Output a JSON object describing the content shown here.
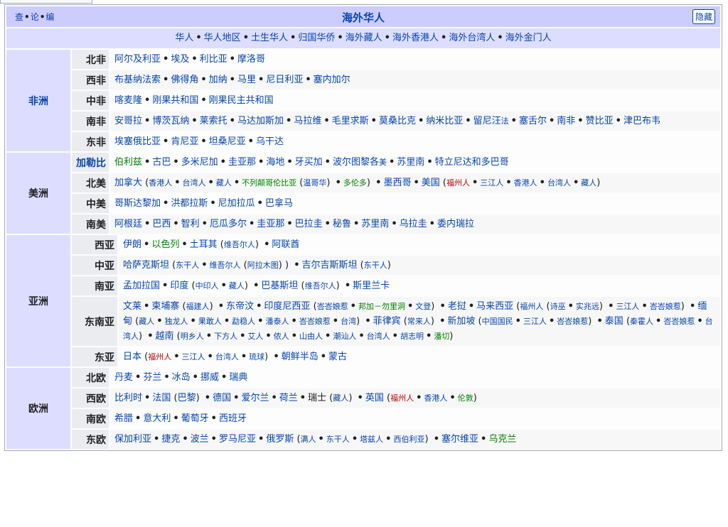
{
  "vte": [
    {
      "label": "查",
      "href_kind": "view"
    },
    {
      "label": "论",
      "href_kind": "talk"
    },
    {
      "label": "编",
      "href_kind": "edit"
    }
  ],
  "title": "海外华人",
  "hide_label": "隐藏",
  "subheader": [
    "华人",
    "华人地区",
    "土生华人",
    "归国华侨",
    "海外藏人",
    "海外香港人",
    "海外台湾人",
    "海外金门人"
  ],
  "colors": {
    "title_bg": "#ccccff",
    "group_bg": "#ddddff",
    "row_label_bg": "#eaecf0",
    "link": "#0645ad",
    "link_green": "#008000",
    "link_red": "#ba0000"
  },
  "groups": [
    {
      "name": "非洲",
      "link": true,
      "rows": [
        {
          "label": "北非",
          "text": "[阿尔及利亚] • [埃及] • [利比亚] • [摩洛哥]"
        },
        {
          "label": "西非",
          "text": "[布基纳法索] • [佛得角] • [加纳] • [马里] • [尼日利亚] • [塞内加尔]"
        },
        {
          "label": "中非",
          "text": "[喀麦隆] • [刚果共和国] • [刚果民主共和国]"
        },
        {
          "label": "南非",
          "text": "[安哥拉] • [博茨瓦纳] • [莱索托] • [马达加斯加] • [马拉维] • [毛里求斯] • [莫桑比克] • [纳米比亚] • [留尼汪] {[法]} • [塞舌尔] • [南非] • [赞比亚] • [津巴布韦]"
        },
        {
          "label": "东非",
          "text": "[埃塞俄比亚] • [肯尼亚] • [坦桑尼亚] • [乌干达]"
        }
      ]
    },
    {
      "name": "美洲",
      "link": false,
      "rows": [
        {
          "label": "加勒比",
          "label_link": true,
          "text": "(伯利兹) • [古巴] • [多米尼加] • [圭亚那] • [海地] • [牙买加] • [波尔图黎各] {[美]} • [苏里南] • [特立尼达和多巴哥]"
        },
        {
          "label": "北美",
          "text": "[加拿大] { ( [香港人] • [台湾人] • [藏人] • (不列颠哥伦比亚) ( [温哥华] ) • (多伦多) ) } • [墨西哥] • [美国] { ( <福州人> • [三江人] • [香港人] • [台湾人] • [藏人] ) }"
        },
        {
          "label": "中美",
          "text": "[哥斯达黎加] • [洪都拉斯] • [尼加拉瓜] • [巴拿马]"
        },
        {
          "label": "南美",
          "text": "[阿根廷] • [巴西] • [智利] • [厄瓜多尔] • [圭亚那] • [巴拉圭] • [秘鲁] • [苏里南] • [乌拉圭] • [委内瑞拉]"
        }
      ]
    },
    {
      "name": "亚洲",
      "link": false,
      "rows": [
        {
          "label": "西亚",
          "text": "[伊朗] • (以色列) • [土耳其] { ( [维吾尔人] ) } • [阿联酋]"
        },
        {
          "label": "中亚",
          "text": "[哈萨克斯坦] { ( [东干人] • [维吾尔人] ( [阿拉木图] ) ) } • [吉尔吉斯斯坦] { ( [东干人] ) }"
        },
        {
          "label": "南亚",
          "text": "[孟加拉国] • [印度] { ( [中印人] • [藏人] ) } • [巴基斯坦] { ( [维吾尔人] ) } • [斯里兰卡]"
        },
        {
          "label": "东南亚",
          "text": "[文莱] • [柬埔寨] { ( [福建人] ) } • [东帝汶] • [印度尼西亚] { ( [峇峇娘惹] • (邦加－勿里洞) • [文登] ) } • [老挝] • [马来西亚] { ( [福州人] ( [诗巫] • [实兆远] ) • [三江人] • [峇峇娘惹] ) } • [缅甸] { ( [藏人] • [独龙人] • [果敢人] • [勐稳人] • [潘泰人] • [峇峇娘惹] • [台湾] ) } • [菲律宾] { ( [常来人] ) } • [新加坡] { ( [中国国民] • [三江人] • [峇峇娘惹] ) } • [泰国] { ( [秦霍人] • [峇峇娘惹] • [台湾人] ) } • [越南] { ( [明乡人] • [下方人] • [艾人] • [侬人] • [山由人] • [潮汕人] • [台湾人] • [胡志明] • (潘切) ) }"
        },
        {
          "label": "东亚",
          "text": "[日本] { ( <福州人> • [三江人] • [台湾人] • [琉球] ) } • [朝鲜半岛] • [蒙古]"
        }
      ]
    },
    {
      "name": "欧洲",
      "link": false,
      "rows": [
        {
          "label": "北欧",
          "text": "[丹麦] • [芬兰] • [冰岛] • [挪威] • [瑞典]"
        },
        {
          "label": "西欧",
          "text": "[比利时] • [法国] ( [巴黎] ) • [德国] • [爱尔兰] • [荷兰] • ^瑞士^ { ( [藏人] ) } • [英国] { ( <福州人> • [香港人] • (伦敦) ) }"
        },
        {
          "label": "南欧",
          "text": "[希腊] • [意大利] • [葡萄牙] • [西班牙]"
        },
        {
          "label": "东欧",
          "text": "[保加利亚] • [捷克] • [波兰] • [罗马尼亚] • [俄罗斯] { ( [满人] • [东干人] • [塔兹人] • [西伯利亚] ) } • [塞尔维亚] • (乌克兰)"
        }
      ]
    }
  ]
}
